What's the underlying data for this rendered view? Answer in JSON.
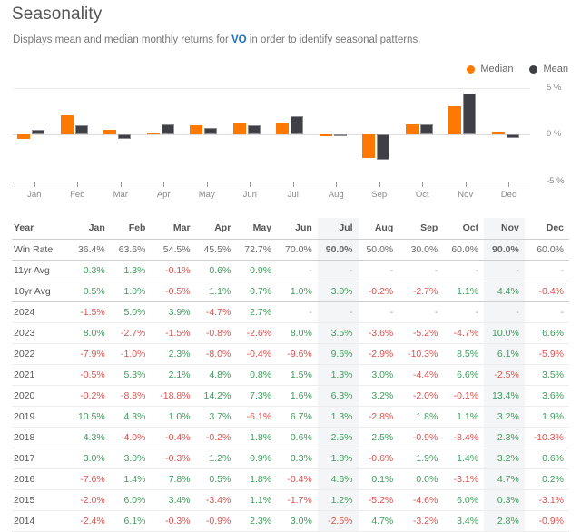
{
  "header": {
    "title": "Seasonality",
    "subtitle_pre": "Displays mean and median monthly returns for ",
    "ticker": "VO",
    "subtitle_post": " in order to identify seasonal patterns."
  },
  "legend": {
    "median_label": "Median",
    "mean_label": "Mean",
    "median_color": "#FF7900",
    "mean_color": "#3f3f46"
  },
  "chart_data": {
    "type": "bar",
    "title": "Seasonality",
    "xlabel": "",
    "ylabel": "",
    "ylim": [
      -5,
      5
    ],
    "ytick_labels": [
      "5 %",
      "0 %",
      "-5 %"
    ],
    "ytick_values": [
      5,
      0,
      -5
    ],
    "grid": true,
    "legend_position": "top-right",
    "categories": [
      "Jan",
      "Feb",
      "Mar",
      "Apr",
      "May",
      "Jun",
      "Jul",
      "Aug",
      "Sep",
      "Oct",
      "Nov",
      "Dec"
    ],
    "series": [
      {
        "name": "Median",
        "color": "#FF7900",
        "values": [
          -0.5,
          2.1,
          0.5,
          0.2,
          1.0,
          1.2,
          1.3,
          -0.1,
          -2.5,
          1.1,
          3.0,
          0.3
        ]
      },
      {
        "name": "Mean",
        "color": "#3f3f46",
        "values": [
          0.5,
          1.0,
          -0.5,
          1.1,
          0.7,
          1.0,
          2.0,
          -0.1,
          -2.7,
          1.1,
          4.4,
          -0.4
        ]
      }
    ]
  },
  "table": {
    "columns": [
      "Year",
      "Jan",
      "Feb",
      "Mar",
      "Apr",
      "May",
      "Jun",
      "Jul",
      "Aug",
      "Sep",
      "Oct",
      "Nov",
      "Dec"
    ],
    "highlight_columns": [
      "Jul",
      "Nov"
    ],
    "rows": [
      {
        "label": "Win Rate",
        "kind": "winrate",
        "values": [
          "36.4%",
          "63.6%",
          "54.5%",
          "45.5%",
          "72.7%",
          "70.0%",
          "90.0%",
          "50.0%",
          "30.0%",
          "60.0%",
          "90.0%",
          "60.0%"
        ]
      },
      {
        "label": "11yr Avg",
        "kind": "avg",
        "values": [
          "0.3%",
          "1.3%",
          "-0.1%",
          "0.6%",
          "0.9%",
          "-",
          "-",
          "-",
          "-",
          "-",
          "-",
          "-"
        ]
      },
      {
        "label": "10yr Avg",
        "kind": "avg",
        "values": [
          "0.5%",
          "1.0%",
          "-0.5%",
          "1.1%",
          "0.7%",
          "1.0%",
          "3.0%",
          "-0.2%",
          "-2.7%",
          "1.1%",
          "4.4%",
          "-0.4%"
        ]
      },
      {
        "label": "2024",
        "kind": "year",
        "values": [
          "-1.5%",
          "5.0%",
          "3.9%",
          "-4.7%",
          "2.7%",
          "-",
          "-",
          "-",
          "-",
          "-",
          "-",
          "-"
        ]
      },
      {
        "label": "2023",
        "kind": "year",
        "values": [
          "8.0%",
          "-2.7%",
          "-1.5%",
          "-0.8%",
          "-2.6%",
          "8.0%",
          "3.5%",
          "-3.6%",
          "-5.2%",
          "-4.7%",
          "10.0%",
          "6.6%"
        ]
      },
      {
        "label": "2022",
        "kind": "year",
        "values": [
          "-7.9%",
          "-1.0%",
          "2.3%",
          "-8.0%",
          "-0.4%",
          "-9.6%",
          "9.6%",
          "-2.9%",
          "-10.3%",
          "8.5%",
          "6.1%",
          "-5.9%"
        ]
      },
      {
        "label": "2021",
        "kind": "year",
        "values": [
          "-0.5%",
          "5.3%",
          "2.1%",
          "4.8%",
          "0.8%",
          "1.5%",
          "1.3%",
          "3.0%",
          "-4.4%",
          "6.6%",
          "-2.5%",
          "3.5%"
        ]
      },
      {
        "label": "2020",
        "kind": "year",
        "values": [
          "-0.2%",
          "-8.8%",
          "-18.8%",
          "14.2%",
          "7.3%",
          "1.6%",
          "6.3%",
          "3.2%",
          "-2.0%",
          "-0.1%",
          "13.4%",
          "3.6%"
        ]
      },
      {
        "label": "2019",
        "kind": "year",
        "values": [
          "10.5%",
          "4.3%",
          "1.0%",
          "3.7%",
          "-6.1%",
          "6.7%",
          "1.3%",
          "-2.8%",
          "1.8%",
          "1.1%",
          "3.2%",
          "1.9%"
        ]
      },
      {
        "label": "2018",
        "kind": "year",
        "values": [
          "4.3%",
          "-4.0%",
          "-0.4%",
          "-0.2%",
          "1.8%",
          "0.6%",
          "2.5%",
          "2.5%",
          "-0.9%",
          "-8.4%",
          "2.3%",
          "-10.3%"
        ]
      },
      {
        "label": "2017",
        "kind": "year",
        "values": [
          "3.0%",
          "3.0%",
          "-0.3%",
          "1.2%",
          "0.9%",
          "0.3%",
          "1.8%",
          "-0.6%",
          "1.9%",
          "1.4%",
          "3.2%",
          "0.6%"
        ]
      },
      {
        "label": "2016",
        "kind": "year",
        "values": [
          "-7.6%",
          "1.4%",
          "7.8%",
          "0.5%",
          "1.8%",
          "-0.4%",
          "4.6%",
          "0.1%",
          "0.0%",
          "-3.1%",
          "4.7%",
          "0.2%"
        ]
      },
      {
        "label": "2015",
        "kind": "year",
        "values": [
          "-2.0%",
          "6.0%",
          "3.4%",
          "-3.4%",
          "1.1%",
          "-1.7%",
          "1.2%",
          "-5.2%",
          "-4.6%",
          "6.0%",
          "0.3%",
          "-3.1%"
        ]
      },
      {
        "label": "2014",
        "kind": "year",
        "values": [
          "-2.4%",
          "6.1%",
          "-0.3%",
          "-0.9%",
          "2.3%",
          "3.0%",
          "-2.5%",
          "4.7%",
          "-3.2%",
          "3.4%",
          "2.8%",
          "-0.9%"
        ]
      }
    ]
  },
  "colors": {
    "positive": "#3f9a5c",
    "negative": "#d9534f",
    "link": "#1a6ecc",
    "highlight_bg": "#f4f5f7"
  }
}
